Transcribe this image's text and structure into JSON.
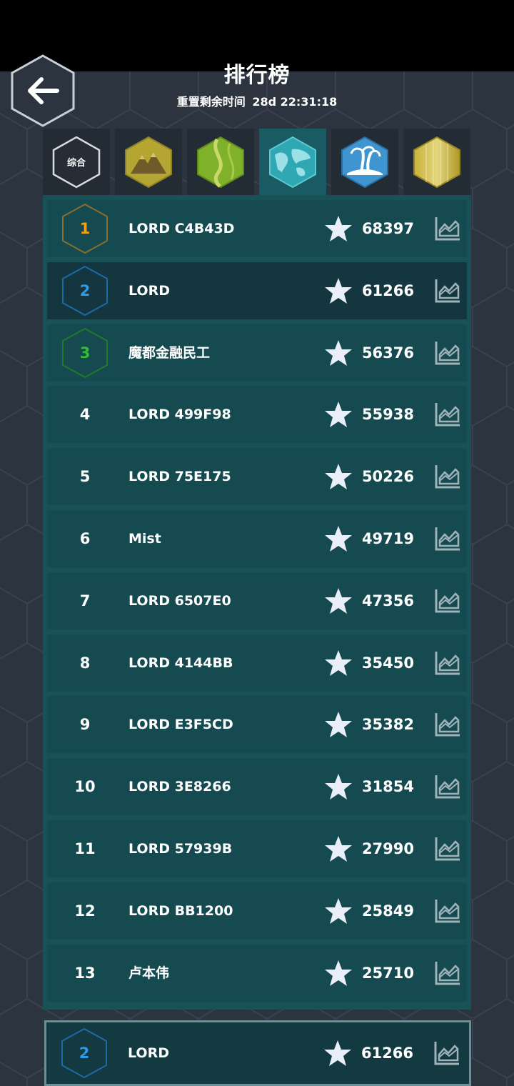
{
  "header": {
    "title": "排行榜",
    "reset_label": "重置剩余时间",
    "reset_time": "28d 22:31:18"
  },
  "tabs": [
    {
      "label": "综合",
      "icon": "overall-hex-icon",
      "active": false
    },
    {
      "label": "",
      "icon": "mountain-hex-icon",
      "active": false
    },
    {
      "label": "",
      "icon": "grassland-hex-icon",
      "active": false
    },
    {
      "label": "",
      "icon": "world-map-hex-icon",
      "active": true
    },
    {
      "label": "",
      "icon": "island-palm-hex-icon",
      "active": false
    },
    {
      "label": "",
      "icon": "gold-hex-icon",
      "active": false
    }
  ],
  "leaderboard": [
    {
      "rank": "1",
      "name": "LORD C4B43D",
      "score": "68397"
    },
    {
      "rank": "2",
      "name": "LORD",
      "score": "61266"
    },
    {
      "rank": "3",
      "name": "魔都金融民工",
      "score": "56376"
    },
    {
      "rank": "4",
      "name": "LORD 499F98",
      "score": "55938"
    },
    {
      "rank": "5",
      "name": "LORD 75E175",
      "score": "50226"
    },
    {
      "rank": "6",
      "name": "Mist",
      "score": "49719"
    },
    {
      "rank": "7",
      "name": "LORD 6507E0",
      "score": "47356"
    },
    {
      "rank": "8",
      "name": "LORD 4144BB",
      "score": "35450"
    },
    {
      "rank": "9",
      "name": "LORD E3F5CD",
      "score": "35382"
    },
    {
      "rank": "10",
      "name": "LORD 3E8266",
      "score": "31854"
    },
    {
      "rank": "11",
      "name": "LORD 57939B",
      "score": "27990"
    },
    {
      "rank": "12",
      "name": "LORD BB1200",
      "score": "25849"
    },
    {
      "rank": "13",
      "name": "卢本伟",
      "score": "25710"
    }
  ],
  "my_entry": {
    "rank": "2",
    "name": "LORD",
    "score": "61266"
  },
  "colors": {
    "rank1": "#f0a020",
    "rank2": "#2f9be8",
    "rank3": "#2fc02f",
    "rank1_border": "#8a6e2c",
    "rank2_border": "#1c6aa8",
    "rank3_border": "#1f7a2a",
    "row": "#154a51",
    "row_highlight": "#13363f",
    "panel": "#185157"
  }
}
